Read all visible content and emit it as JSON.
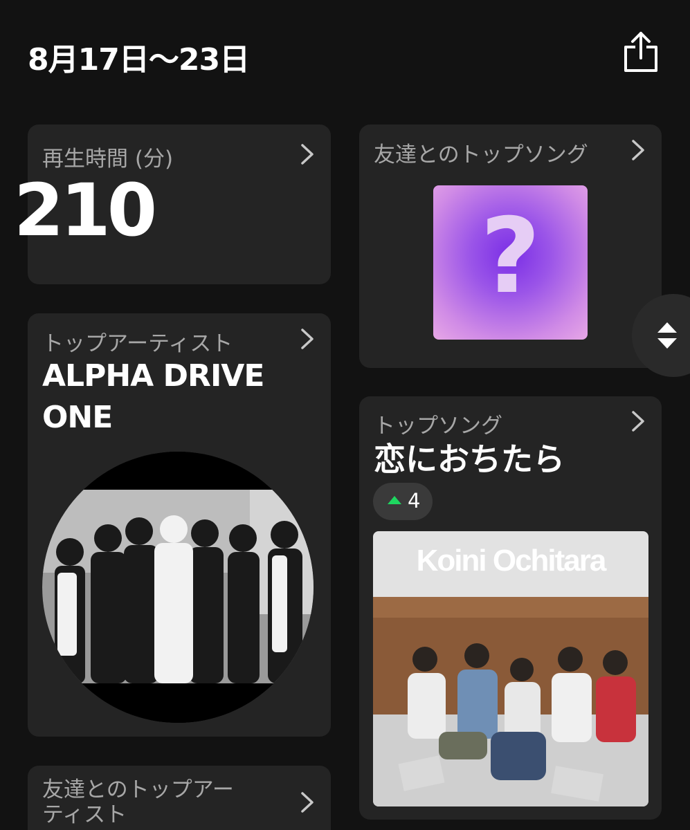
{
  "header": {
    "date_range": "8月17日〜23日"
  },
  "icons": {
    "share": "share-icon",
    "chevron": "chevron-right-icon",
    "scroll": "up-down-arrows-icon"
  },
  "cards": {
    "minutes": {
      "label": "再生時間 (分)",
      "value": "210"
    },
    "friends_top_song": {
      "label": "友達とのトップソング",
      "art_symbol": "?"
    },
    "top_artist": {
      "label": "トップアーティスト",
      "name": "ALPHA DRIVE ONE"
    },
    "top_song": {
      "label": "トップソング",
      "title": "恋におちたら",
      "rank_change": "4",
      "rank_direction": "up",
      "album_art_title": "Koini Ochitara"
    },
    "friends_top_artist": {
      "label": "友達とのトップアーティスト"
    }
  },
  "colors": {
    "background": "#121212",
    "card": "#242424",
    "accent_green": "#1ed760",
    "label_gray": "#a7a7a7"
  }
}
